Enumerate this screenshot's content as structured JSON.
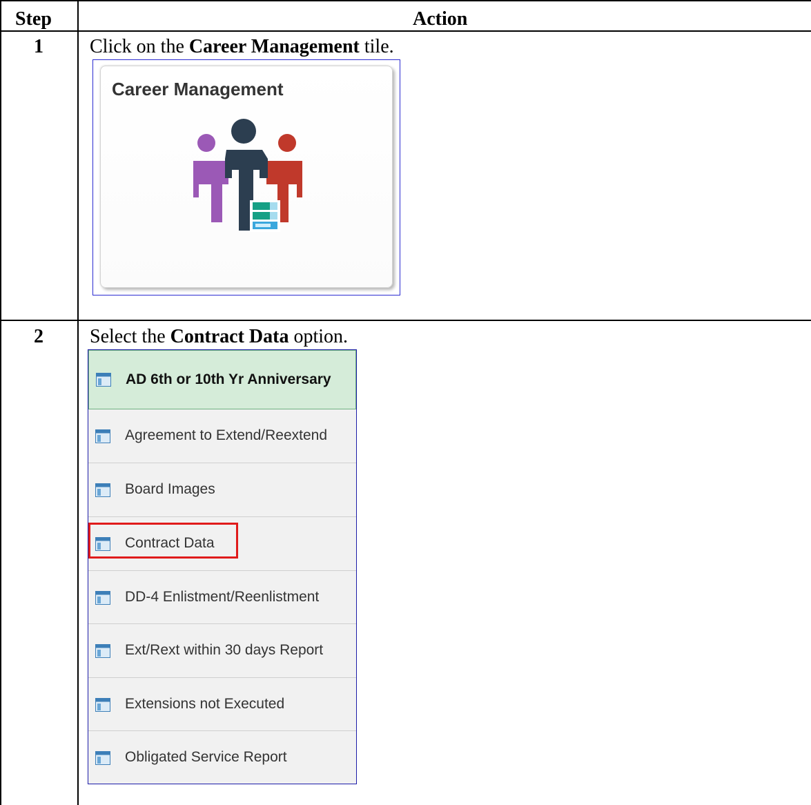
{
  "table": {
    "headers": {
      "step": "Step",
      "action": "Action"
    },
    "rows": [
      {
        "step": "1",
        "instruction_pre": "Click on the ",
        "instruction_bold": "Career Management",
        "instruction_post": " tile.",
        "tile": {
          "title": "Career Management",
          "icon": "career-people-icon",
          "colors": {
            "left_person": "#9b59b6",
            "center_person": "#2c3e50",
            "right_person": "#c0392b",
            "docs": "#16a085"
          }
        }
      },
      {
        "step": "2",
        "instruction_pre": "Select the ",
        "instruction_bold": "Contract Data",
        "instruction_post": " option.",
        "menu": {
          "items": [
            {
              "label": "AD 6th or 10th Yr Anniversary",
              "icon": "page-icon",
              "active": true
            },
            {
              "label": "Agreement to Extend/Reextend",
              "icon": "page-icon"
            },
            {
              "label": "Board Images",
              "icon": "page-icon"
            },
            {
              "label": "Contract Data",
              "icon": "page-icon",
              "highlighted": true
            },
            {
              "label": "DD-4 Enlistment/Reenlistment",
              "icon": "page-icon"
            },
            {
              "label": "Ext/Rext within 30 days Report",
              "icon": "page-icon"
            },
            {
              "label": "Extensions not Executed",
              "icon": "page-icon"
            },
            {
              "label": "Obligated Service Report",
              "icon": "page-icon"
            }
          ],
          "colors": {
            "active_bg": "#d5ecd9",
            "highlight": "#e01b1b",
            "border": "#1b1ba8"
          }
        }
      }
    ]
  }
}
